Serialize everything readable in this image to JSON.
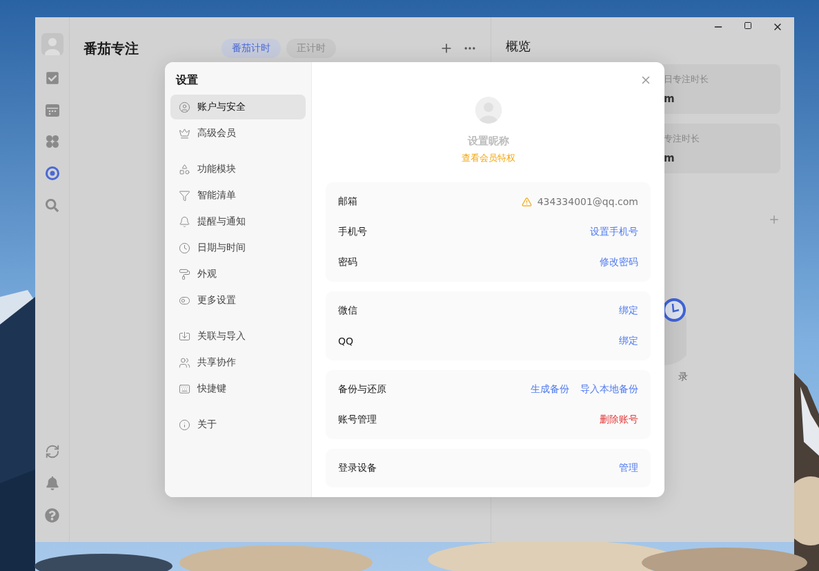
{
  "sidebar": {
    "items": [
      {
        "kind": "tasks",
        "selected": false
      },
      {
        "kind": "calendar",
        "selected": false
      },
      {
        "kind": "petals",
        "selected": false
      },
      {
        "kind": "focus",
        "selected": true
      },
      {
        "kind": "search",
        "selected": false
      }
    ],
    "bottom_items": [
      {
        "kind": "sync"
      },
      {
        "kind": "bell"
      },
      {
        "kind": "help"
      }
    ]
  },
  "header": {
    "title": "番茄专注",
    "tabs": [
      {
        "label": "番茄计时",
        "selected": true
      },
      {
        "label": "正计时",
        "selected": false
      }
    ]
  },
  "overview": {
    "title": "概览",
    "cards": [
      {
        "label": "日专注时长",
        "value": "m"
      },
      {
        "label": "专注时长",
        "value": "m"
      }
    ],
    "empty_text": "录"
  },
  "settings": {
    "title": "设置",
    "nav_groups": [
      {
        "items": [
          {
            "kind": "account",
            "label": "账户与安全",
            "selected": true
          },
          {
            "kind": "vip",
            "label": "高级会员",
            "selected": false
          }
        ]
      },
      {
        "items": [
          {
            "kind": "modules",
            "label": "功能模块",
            "selected": false
          },
          {
            "kind": "lists",
            "label": "智能清单",
            "selected": false
          },
          {
            "kind": "notify",
            "label": "提醒与通知",
            "selected": false
          },
          {
            "kind": "datetime",
            "label": "日期与时间",
            "selected": false
          },
          {
            "kind": "appearance",
            "label": "外观",
            "selected": false
          },
          {
            "kind": "more",
            "label": "更多设置",
            "selected": false
          }
        ]
      },
      {
        "items": [
          {
            "kind": "import",
            "label": "关联与导入",
            "selected": false
          },
          {
            "kind": "share",
            "label": "共享协作",
            "selected": false
          },
          {
            "kind": "shortcuts",
            "label": "快捷键",
            "selected": false
          }
        ]
      },
      {
        "items": [
          {
            "kind": "about",
            "label": "关于",
            "selected": false
          }
        ]
      }
    ],
    "profile": {
      "nickname": "设置昵称",
      "vip_link": "查看会员特权"
    },
    "sections": [
      {
        "rows": [
          {
            "label": "邮箱",
            "actions": [
              {
                "kind": "warning",
                "text": "434334001@qq.com"
              }
            ]
          },
          {
            "label": "手机号",
            "actions": [
              {
                "kind": "link",
                "text": "设置手机号"
              }
            ]
          },
          {
            "label": "密码",
            "actions": [
              {
                "kind": "link",
                "text": "修改密码"
              }
            ]
          }
        ]
      },
      {
        "rows": [
          {
            "label": "微信",
            "actions": [
              {
                "kind": "link",
                "text": "绑定"
              }
            ]
          },
          {
            "label": "QQ",
            "actions": [
              {
                "kind": "link",
                "text": "绑定"
              }
            ]
          }
        ]
      },
      {
        "rows": [
          {
            "label": "备份与还原",
            "actions": [
              {
                "kind": "link",
                "text": "生成备份"
              },
              {
                "kind": "link",
                "text": "导入本地备份"
              }
            ]
          },
          {
            "label": "账号管理",
            "actions": [
              {
                "kind": "danger",
                "text": "删除账号"
              }
            ]
          }
        ]
      },
      {
        "rows": [
          {
            "label": "登录设备",
            "actions": [
              {
                "kind": "link",
                "text": "管理"
              }
            ]
          }
        ]
      }
    ]
  }
}
